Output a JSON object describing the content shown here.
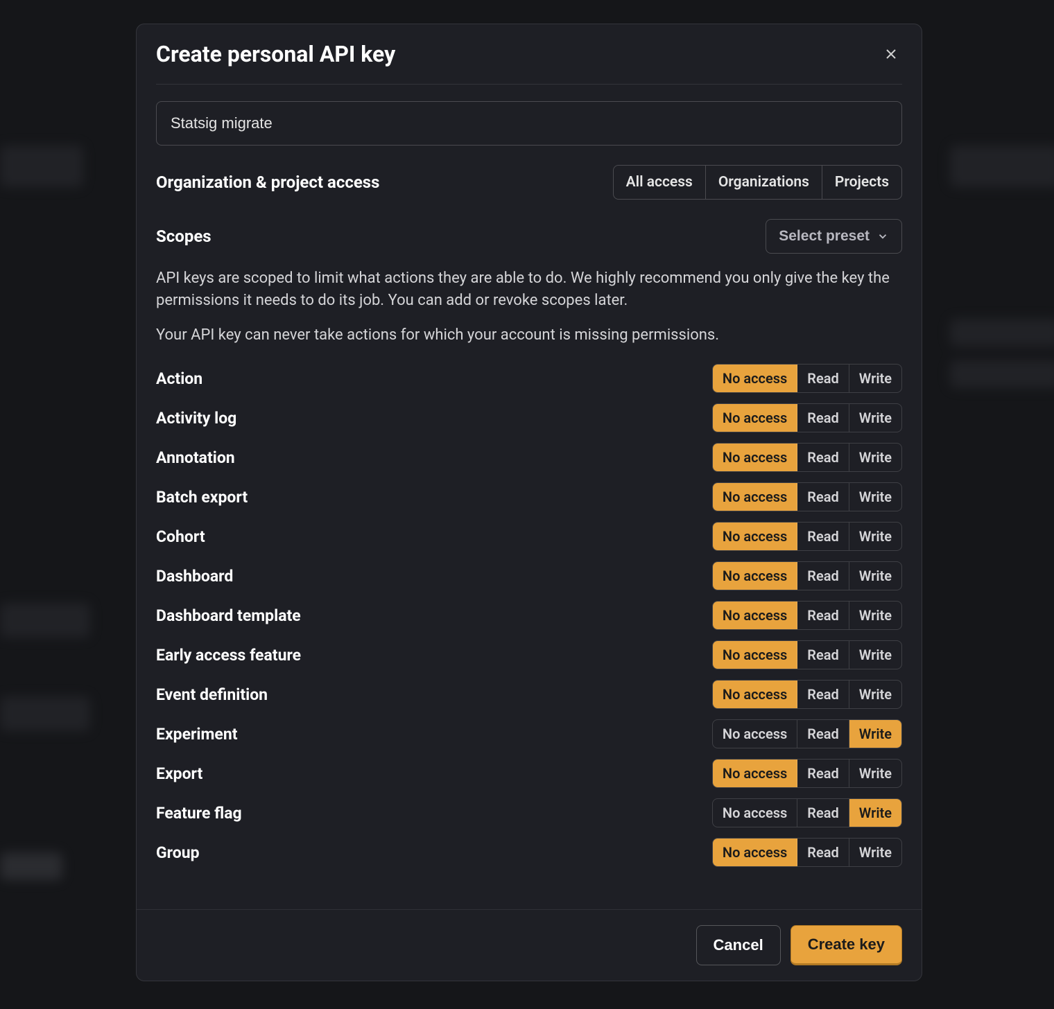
{
  "modal": {
    "title": "Create personal API key",
    "name_input_value": "Statsig migrate",
    "org_access_label": "Organization & project access",
    "org_access_tabs": [
      "All access",
      "Organizations",
      "Projects"
    ],
    "scopes_label": "Scopes",
    "preset_label": "Select preset",
    "scopes_desc_1": "API keys are scoped to limit what actions they are able to do. We highly recommend you only give the key the permissions it needs to do its job. You can add or revoke scopes later.",
    "scopes_desc_2": "Your API key can never take actions for which your account is missing permissions.",
    "scope_options": [
      "No access",
      "Read",
      "Write"
    ],
    "scopes": [
      {
        "name": "Action",
        "selected": 0
      },
      {
        "name": "Activity log",
        "selected": 0
      },
      {
        "name": "Annotation",
        "selected": 0
      },
      {
        "name": "Batch export",
        "selected": 0
      },
      {
        "name": "Cohort",
        "selected": 0
      },
      {
        "name": "Dashboard",
        "selected": 0
      },
      {
        "name": "Dashboard template",
        "selected": 0
      },
      {
        "name": "Early access feature",
        "selected": 0
      },
      {
        "name": "Event definition",
        "selected": 0
      },
      {
        "name": "Experiment",
        "selected": 2
      },
      {
        "name": "Export",
        "selected": 0
      },
      {
        "name": "Feature flag",
        "selected": 2
      },
      {
        "name": "Group",
        "selected": 0
      }
    ],
    "cancel_label": "Cancel",
    "create_label": "Create key"
  }
}
